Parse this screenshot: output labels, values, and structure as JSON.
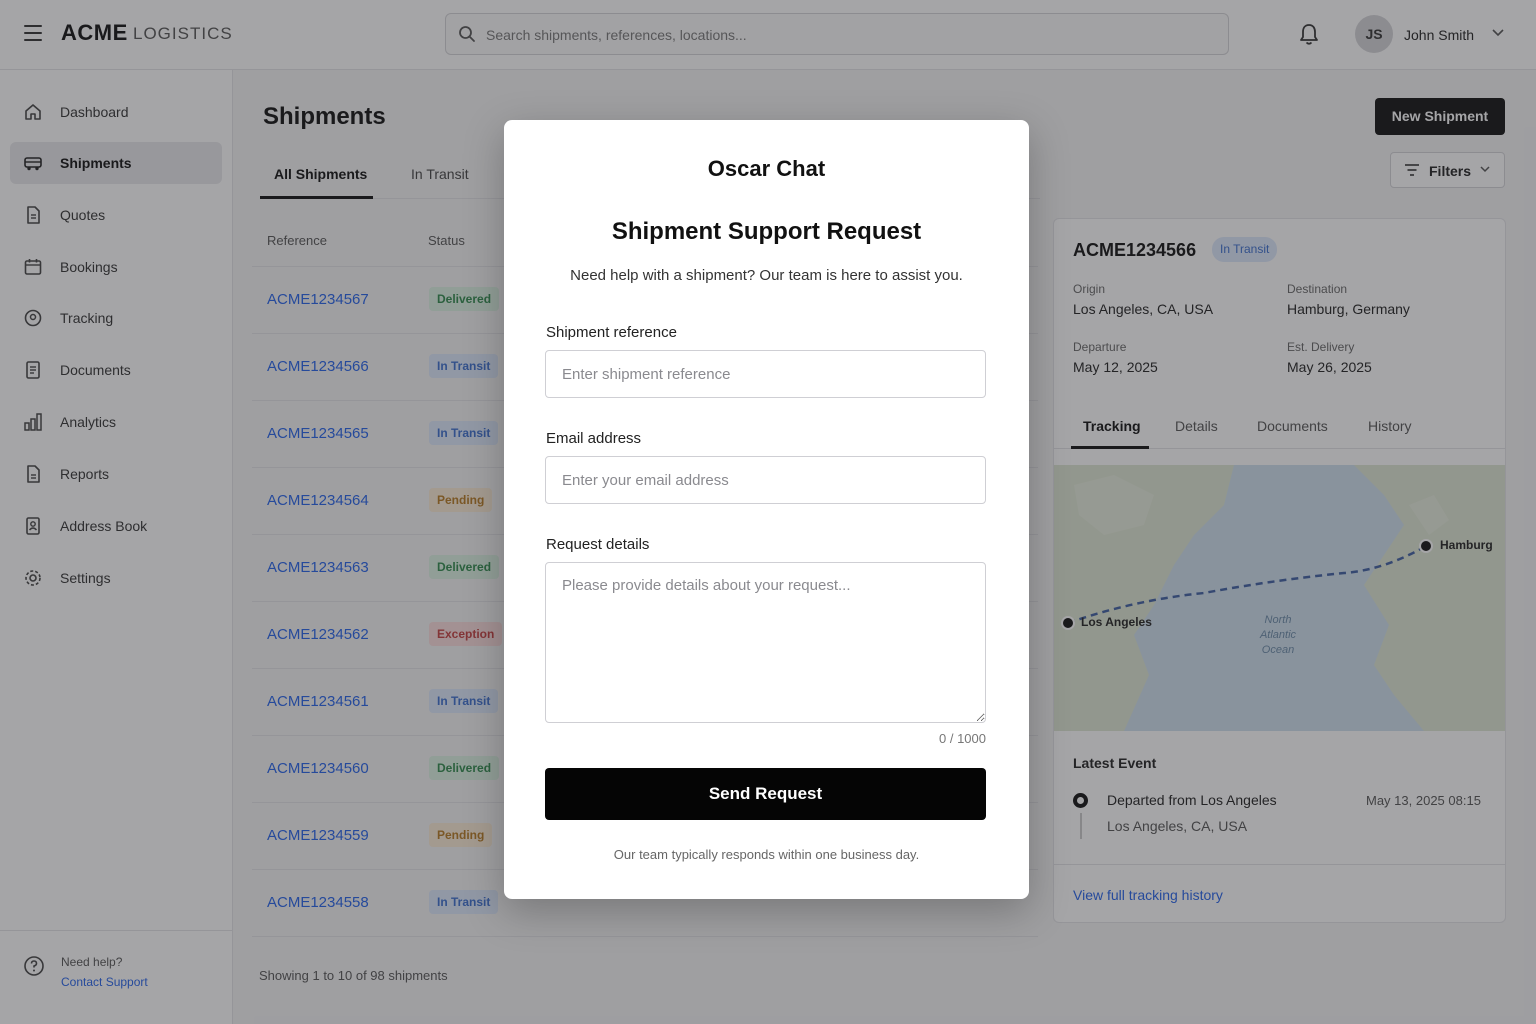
{
  "header": {
    "brand": "ACME",
    "brand_sub": "LOGISTICS",
    "search_placeholder": "Search shipments, references, locations...",
    "user_initials": "JS",
    "user_name": "John Smith"
  },
  "sidebar": {
    "items": [
      {
        "label": "Dashboard",
        "icon": "home-icon"
      },
      {
        "label": "Shipments",
        "icon": "truck-icon",
        "active": true
      },
      {
        "label": "Quotes",
        "icon": "document-icon"
      },
      {
        "label": "Bookings",
        "icon": "calendar-icon"
      },
      {
        "label": "Tracking",
        "icon": "location-pin-icon"
      },
      {
        "label": "Documents",
        "icon": "file-icon"
      },
      {
        "label": "Analytics",
        "icon": "bar-chart-icon"
      },
      {
        "label": "Reports",
        "icon": "report-icon"
      },
      {
        "label": "Address Book",
        "icon": "address-book-icon"
      },
      {
        "label": "Settings",
        "icon": "gear-icon"
      }
    ],
    "help_text": "Need help?",
    "help_link": "Contact Support"
  },
  "main": {
    "title": "Shipments",
    "tabs": [
      "All Shipments",
      "In Transit"
    ],
    "new_button": "New Shipment",
    "filters_button": "Filters",
    "columns": [
      "Reference",
      "Status"
    ],
    "rows": [
      {
        "ref": "ACME1234567",
        "status": "Delivered"
      },
      {
        "ref": "ACME1234566",
        "status": "In Transit"
      },
      {
        "ref": "ACME1234565",
        "status": "In Transit"
      },
      {
        "ref": "ACME1234564",
        "status": "Pending"
      },
      {
        "ref": "ACME1234563",
        "status": "Delivered"
      },
      {
        "ref": "ACME1234562",
        "status": "Exception"
      },
      {
        "ref": "ACME1234561",
        "status": "In Transit"
      },
      {
        "ref": "ACME1234560",
        "status": "Delivered"
      },
      {
        "ref": "ACME1234559",
        "status": "Pending"
      },
      {
        "ref": "ACME1234558",
        "status": "In Transit"
      }
    ],
    "showing": "Showing 1 to 10 of 98 shipments"
  },
  "detail": {
    "ref": "ACME1234566",
    "status": "In Transit",
    "origin_label": "Origin",
    "origin": "Los Angeles, CA, USA",
    "destination_label": "Destination",
    "destination": "Hamburg, Germany",
    "departure_label": "Departure",
    "departure": "May 12, 2025",
    "delivery_label": "Est. Delivery",
    "delivery": "May 26, 2025",
    "tabs": [
      "Tracking",
      "Details",
      "Documents",
      "History"
    ],
    "map": {
      "from": "Los Angeles",
      "to": "Hamburg",
      "ocean": [
        "North",
        "Atlantic",
        "Ocean"
      ]
    },
    "latest_label": "Latest Event",
    "event_title": "Departed from Los Angeles",
    "event_location": "Los Angeles, CA, USA",
    "event_time": "May 13, 2025  08:15",
    "view_full": "View full tracking history"
  },
  "modal": {
    "title": "Oscar Chat",
    "heading": "Shipment Support Request",
    "subtitle": "Need help with a shipment? Our team is here to assist you.",
    "ref_label": "Shipment reference",
    "ref_placeholder": "Enter shipment reference",
    "email_label": "Email address",
    "email_placeholder": "Enter your email address",
    "details_label": "Request details",
    "details_placeholder": "Please provide details about your request...",
    "char_count": "0 / 1000",
    "send_button": "Send Request",
    "footer": "Our team typically responds within one business day."
  }
}
